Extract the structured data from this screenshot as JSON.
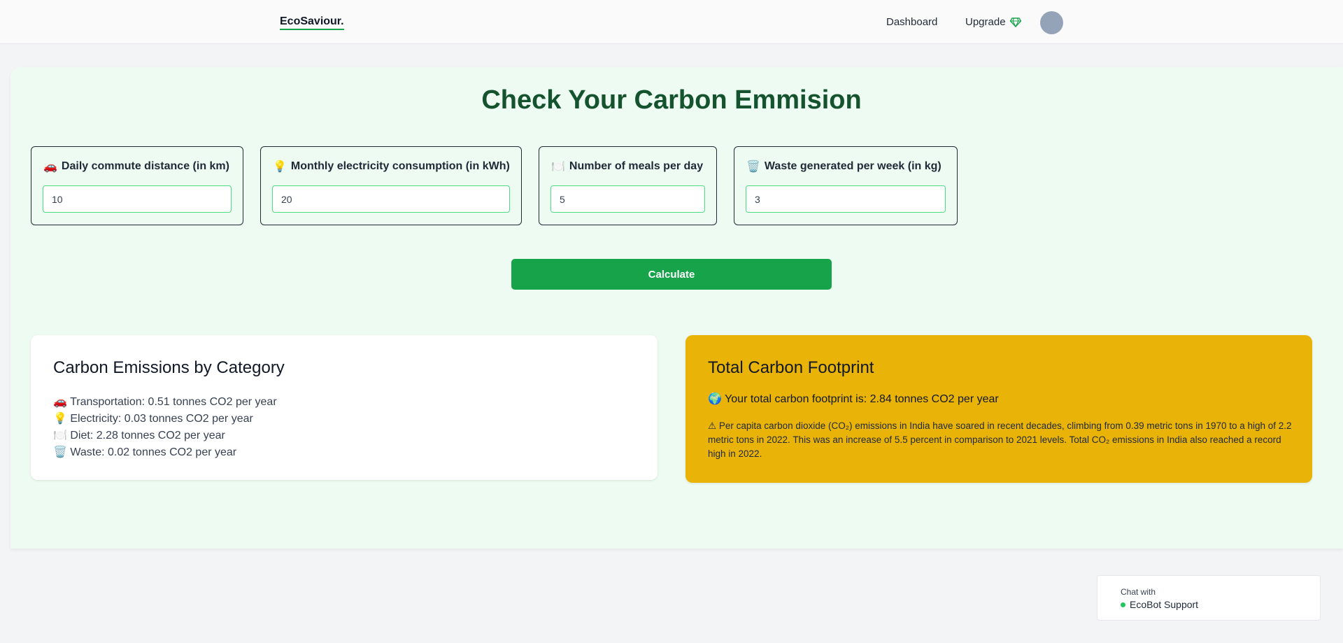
{
  "nav": {
    "brand": "EcoSaviour.",
    "dashboard_label": "Dashboard",
    "upgrade_label": "Upgrade",
    "upgrade_icon": "gem-icon",
    "accent_color": "#16a34a"
  },
  "main": {
    "title": "Check Your Carbon Emmision",
    "inputs": [
      {
        "icon": "🚗",
        "label": "Daily commute distance (in km)",
        "value": "10"
      },
      {
        "icon": "💡",
        "label": "Monthly electricity consumption (in kWh)",
        "value": "20"
      },
      {
        "icon": "🍽️",
        "label": "Number of meals per day",
        "value": "5"
      },
      {
        "icon": "🗑️",
        "label": "Waste generated per week (in kg)",
        "value": "3"
      }
    ],
    "calculate_label": "Calculate"
  },
  "results": {
    "title": "Carbon Emissions by Category",
    "items": [
      {
        "icon": "🚗",
        "text": "Transportation: 0.51 tonnes CO2 per year"
      },
      {
        "icon": "💡",
        "text": "Electricity: 0.03 tonnes CO2 per year"
      },
      {
        "icon": "🍽️",
        "text": "Diet: 2.28 tonnes CO2 per year"
      },
      {
        "icon": "🗑️",
        "text": "Waste: 0.02 tonnes CO2 per year"
      }
    ]
  },
  "total": {
    "title": "Total Carbon Footprint",
    "icon": "🌍",
    "line": "Your total carbon footprint is: 2.84 tonnes CO2 per year",
    "note_icon": "⚠",
    "note": "Per capita carbon dioxide (CO₂) emissions in India have soared in recent decades, climbing from 0.39 metric tons in 1970 to a high of 2.2 metric tons in 2022. This was an increase of 5.5 percent in comparison to 2021 levels. Total CO₂ emissions in India also reached a record high in 2022.",
    "background_color": "#eab308"
  },
  "chat": {
    "with_label": "Chat with",
    "name": "EcoBot Support",
    "status_color": "#22c55e"
  }
}
